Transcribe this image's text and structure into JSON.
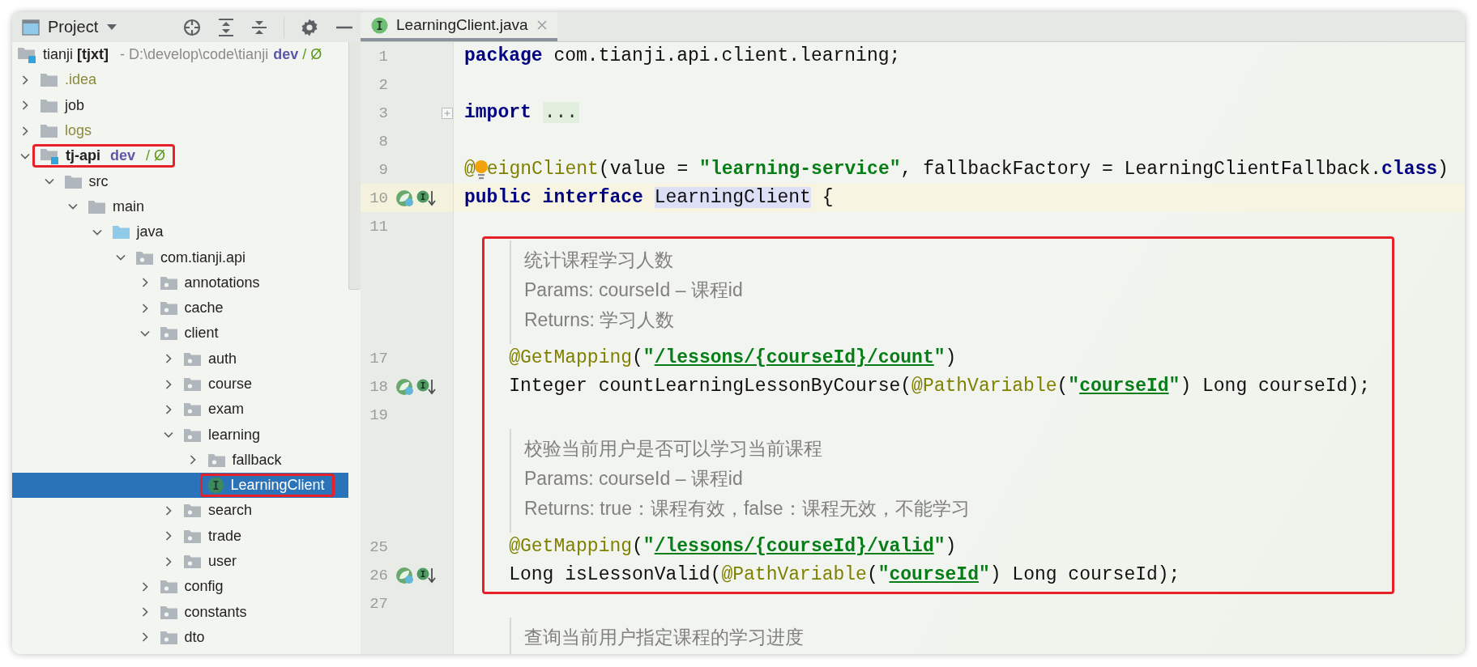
{
  "tool_window": {
    "title": "Project"
  },
  "project_root": {
    "label": "tianji **[tjxt]**",
    "path": "- D:\\develop\\code\\tianji",
    "branch": "dev",
    "branch_suffix": "/ Ø"
  },
  "tree": [
    {
      "kind": "folder",
      "label": ".idea",
      "expanded": false,
      "ignored": true,
      "selected": false,
      "framed": false
    },
    {
      "kind": "folder",
      "label": "job",
      "expanded": false,
      "ignored": false,
      "selected": false,
      "framed": false
    },
    {
      "kind": "folder",
      "label": "logs",
      "expanded": false,
      "ignored": true,
      "selected": false,
      "framed": false
    },
    {
      "kind": "module",
      "label": "tj-api",
      "branch": "dev",
      "branch_suffix": "/ Ø",
      "expanded": true,
      "ignored": false,
      "selected": false,
      "framed": true,
      "children": [
        {
          "kind": "folder",
          "label": "src",
          "expanded": true,
          "ignored": false,
          "selected": false,
          "framed": false,
          "children": [
            {
              "kind": "folder",
              "label": "main",
              "expanded": true,
              "ignored": false,
              "selected": false,
              "framed": false,
              "children": [
                {
                  "kind": "source",
                  "label": "java",
                  "expanded": true,
                  "ignored": false,
                  "selected": false,
                  "framed": false,
                  "children": [
                    {
                      "kind": "package",
                      "label": "com.tianji.api",
                      "expanded": true,
                      "ignored": false,
                      "selected": false,
                      "framed": false,
                      "children": [
                        {
                          "kind": "package",
                          "label": "annotations",
                          "expanded": false,
                          "ignored": false,
                          "selected": false,
                          "framed": false
                        },
                        {
                          "kind": "package",
                          "label": "cache",
                          "expanded": false,
                          "ignored": false,
                          "selected": false,
                          "framed": false
                        },
                        {
                          "kind": "package",
                          "label": "client",
                          "expanded": true,
                          "ignored": false,
                          "selected": false,
                          "framed": false,
                          "children": [
                            {
                              "kind": "package",
                              "label": "auth",
                              "expanded": false,
                              "ignored": false,
                              "selected": false,
                              "framed": false
                            },
                            {
                              "kind": "package",
                              "label": "course",
                              "expanded": false,
                              "ignored": false,
                              "selected": false,
                              "framed": false
                            },
                            {
                              "kind": "package",
                              "label": "exam",
                              "expanded": false,
                              "ignored": false,
                              "selected": false,
                              "framed": false
                            },
                            {
                              "kind": "package",
                              "label": "learning",
                              "expanded": true,
                              "ignored": false,
                              "selected": false,
                              "framed": false,
                              "children": [
                                {
                                  "kind": "package",
                                  "label": "fallback",
                                  "expanded": false,
                                  "ignored": false,
                                  "selected": false,
                                  "framed": false
                                },
                                {
                                  "kind": "interface",
                                  "label": "LearningClient",
                                  "ignored": false,
                                  "selected": true,
                                  "framed": true
                                }
                              ]
                            },
                            {
                              "kind": "package",
                              "label": "search",
                              "expanded": false,
                              "ignored": false,
                              "selected": false,
                              "framed": false
                            },
                            {
                              "kind": "package",
                              "label": "trade",
                              "expanded": false,
                              "ignored": false,
                              "selected": false,
                              "framed": false
                            },
                            {
                              "kind": "package",
                              "label": "user",
                              "expanded": false,
                              "ignored": false,
                              "selected": false,
                              "framed": false
                            }
                          ]
                        },
                        {
                          "kind": "package",
                          "label": "config",
                          "expanded": false,
                          "ignored": false,
                          "selected": false,
                          "framed": false
                        },
                        {
                          "kind": "package",
                          "label": "constants",
                          "expanded": false,
                          "ignored": false,
                          "selected": false,
                          "framed": false
                        },
                        {
                          "kind": "package",
                          "label": "dto",
                          "expanded": false,
                          "ignored": false,
                          "selected": false,
                          "framed": false
                        }
                      ]
                    }
                  ]
                }
              ]
            }
          ]
        }
      ]
    }
  ],
  "editor": {
    "tab": {
      "label": "LearningClient.java",
      "selected": true
    },
    "sections": [
      {
        "framed": false,
        "lines": [
          {
            "kind": "code",
            "number": "1",
            "current": false,
            "tokens": [
              {
                "kind": "keyword",
                "text": "package"
              },
              {
                "kind": "plain",
                "text": " com.tianji.api.client.learning;"
              }
            ]
          },
          {
            "kind": "code",
            "number": "2",
            "current": false
          },
          {
            "kind": "code",
            "number": "3",
            "current": false,
            "gutter_icons": [
              {
                "kind": "fold"
              }
            ],
            "tokens": [
              {
                "kind": "keyword",
                "text": "import "
              },
              {
                "kind": "folded",
                "text": "..."
              }
            ]
          },
          {
            "kind": "code",
            "number": "8",
            "current": false
          },
          {
            "kind": "code",
            "number": "9",
            "current": false,
            "tokens": [
              {
                "kind": "annotation",
                "text": "@"
              },
              {
                "kind": "bulb"
              },
              {
                "kind": "annotation",
                "text": "eignClient"
              },
              {
                "kind": "plain",
                "text": "(value = "
              },
              {
                "kind": "string",
                "text": "\"learning-service\""
              },
              {
                "kind": "plain",
                "text": ", fallbackFactory = LearningClientFallback."
              },
              {
                "kind": "keyword",
                "text": "class"
              },
              {
                "kind": "plain",
                "text": ")"
              }
            ]
          },
          {
            "kind": "code",
            "number": "10",
            "current": true,
            "gutter_icons": [
              {
                "kind": "bean"
              },
              {
                "kind": "implemented"
              }
            ],
            "tokens": [
              {
                "kind": "keyword",
                "text": "public interface "
              },
              {
                "kind": "usage",
                "text": "LearningClient"
              },
              {
                "kind": "plain",
                "text": " {"
              }
            ]
          },
          {
            "kind": "code",
            "number": "11",
            "current": false
          }
        ]
      },
      {
        "framed": true,
        "lines": [
          {
            "kind": "doc",
            "text": [
              "统计课程学习人数",
              "Params: courseId – 课程id",
              "Returns: 学习人数"
            ]
          },
          {
            "kind": "code",
            "number": "17",
            "current": false,
            "tokens": [
              {
                "kind": "annotation",
                "text": "    @GetMapping"
              },
              {
                "kind": "plain",
                "text": "("
              },
              {
                "kind": "string",
                "text": "\""
              },
              {
                "kind": "link",
                "text": "/lessons/{courseId}/count"
              },
              {
                "kind": "string",
                "text": "\""
              },
              {
                "kind": "plain",
                "text": ")"
              }
            ]
          },
          {
            "kind": "code",
            "number": "18",
            "current": false,
            "gutter_icons": [
              {
                "kind": "bean"
              },
              {
                "kind": "implemented"
              }
            ],
            "tokens": [
              {
                "kind": "plain",
                "text": "    Integer countLearningLessonByCourse("
              },
              {
                "kind": "annotation",
                "text": "@PathVariable"
              },
              {
                "kind": "plain",
                "text": "("
              },
              {
                "kind": "string",
                "text": "\""
              },
              {
                "kind": "link",
                "text": "courseId"
              },
              {
                "kind": "string",
                "text": "\""
              },
              {
                "kind": "plain",
                "text": ") Long courseId);"
              }
            ]
          },
          {
            "kind": "code",
            "number": "19",
            "current": false
          },
          {
            "kind": "doc",
            "text": [
              "校验当前用户是否可以学习当前课程",
              "Params: courseId – 课程id",
              "Returns: true：课程有效，false：课程无效，不能学习"
            ]
          },
          {
            "kind": "code",
            "number": "25",
            "current": false,
            "tokens": [
              {
                "kind": "annotation",
                "text": "    @GetMapping"
              },
              {
                "kind": "plain",
                "text": "("
              },
              {
                "kind": "string",
                "text": "\""
              },
              {
                "kind": "link",
                "text": "/lessons/{courseId}/valid"
              },
              {
                "kind": "string",
                "text": "\""
              },
              {
                "kind": "plain",
                "text": ")"
              }
            ]
          },
          {
            "kind": "code",
            "number": "26",
            "current": false,
            "gutter_icons": [
              {
                "kind": "bean"
              },
              {
                "kind": "implemented"
              }
            ],
            "tokens": [
              {
                "kind": "plain",
                "text": "    Long isLessonValid("
              },
              {
                "kind": "annotation",
                "text": "@PathVariable"
              },
              {
                "kind": "plain",
                "text": "("
              },
              {
                "kind": "string",
                "text": "\""
              },
              {
                "kind": "link",
                "text": "courseId"
              },
              {
                "kind": "string",
                "text": "\""
              },
              {
                "kind": "plain",
                "text": ") Long courseId);"
              }
            ]
          }
        ]
      },
      {
        "framed": false,
        "lines": [
          {
            "kind": "code",
            "number": "27",
            "current": false
          },
          {
            "kind": "doc",
            "text": [
              "查询当前用户指定课程的学习进度"
            ]
          }
        ]
      }
    ]
  }
}
